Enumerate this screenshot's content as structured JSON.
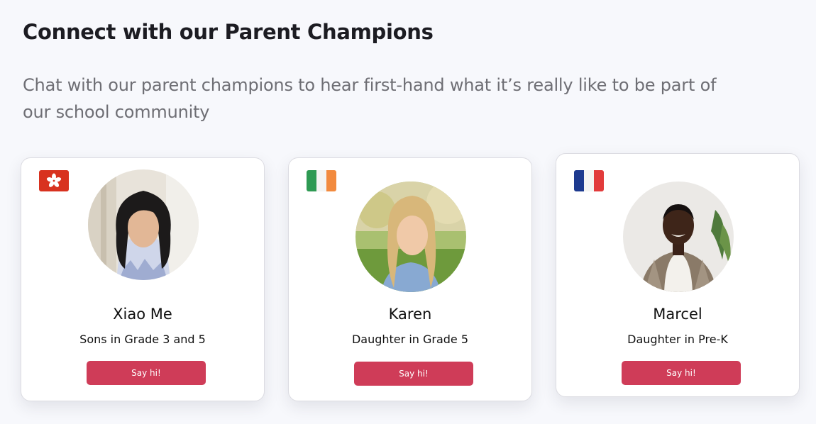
{
  "section": {
    "title": "Connect with our Parent Champions",
    "subtitle": "Chat with our parent champions to hear first-hand what it’s really like to be part of our school community"
  },
  "champions": [
    {
      "name": "Xiao Me",
      "description": "Sons in Grade 3 and 5",
      "button_label": "Say hi!",
      "flag_icon": "hong-kong-flag-icon"
    },
    {
      "name": "Karen",
      "description": "Daughter in Grade 5",
      "button_label": "Say hi!",
      "flag_icon": "ireland-flag-icon"
    },
    {
      "name": "Marcel",
      "description": "Daughter in Pre-K",
      "button_label": "Say hi!",
      "flag_icon": "france-flag-icon"
    }
  ],
  "colors": {
    "background": "#f7f8fc",
    "button": "#cf3c58",
    "title": "#1c1c22",
    "subtitle": "#6e6e74"
  }
}
